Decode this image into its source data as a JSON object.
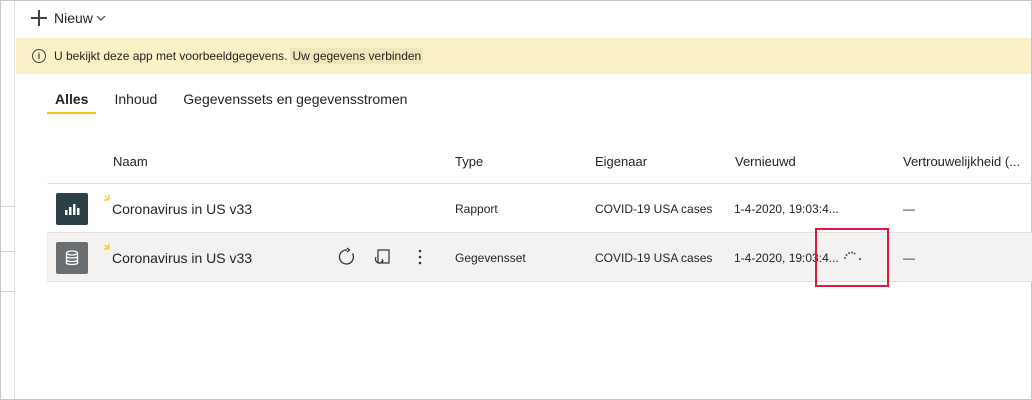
{
  "toolbar": {
    "new_label": "Nieuw"
  },
  "banner": {
    "message": "U bekijkt deze app met voorbeeldgegevens.",
    "connect_label": "Uw gegevens verbinden"
  },
  "tabs": [
    {
      "label": "Alles",
      "active": true
    },
    {
      "label": "Inhoud",
      "active": false
    },
    {
      "label": "Gegevenssets en gegevensstromen",
      "active": false
    }
  ],
  "table": {
    "columns": [
      "Naam",
      "Type",
      "Eigenaar",
      "Vernieuwd",
      "Vertrouwelijkheid (..."
    ],
    "rows": [
      {
        "name": "Coronavirus in US v33",
        "type": "Rapport",
        "owner": "COVID-19 USA cases",
        "refreshed": "1-4-2020, 19:03:4...",
        "sensitivity": "—",
        "icon": "report-icon"
      },
      {
        "name": "Coronavirus in US v33",
        "type": "Gegevensset",
        "owner": "COVID-19 USA cases",
        "refreshed": "1-4-2020, 19:03:4...",
        "sensitivity": "—",
        "icon": "dataset-icon"
      }
    ]
  },
  "colors": {
    "accent": "#f2c811",
    "banner": "#fbf1c7",
    "highlight": "#e0163b"
  }
}
